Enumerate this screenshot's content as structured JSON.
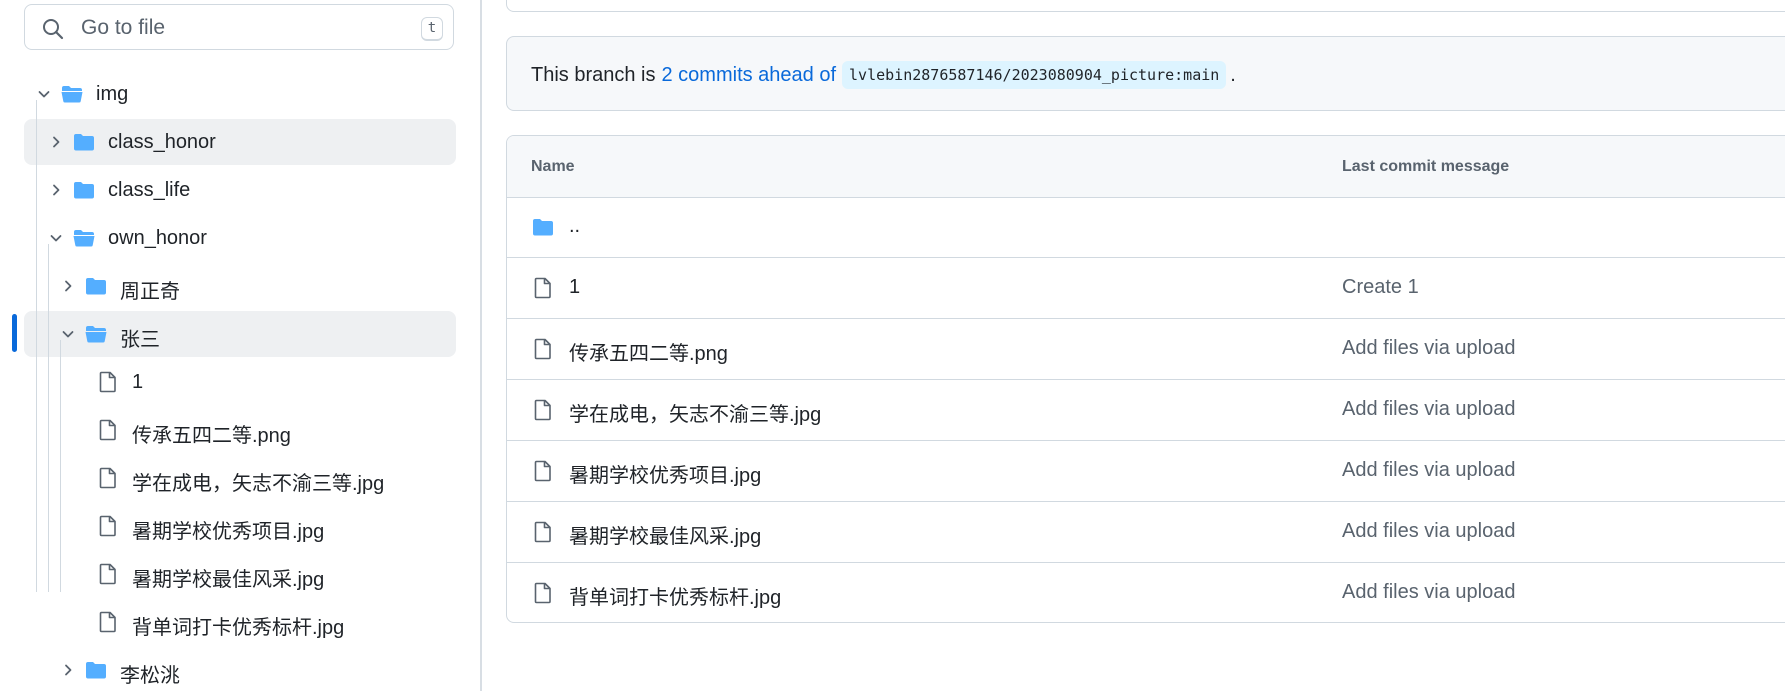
{
  "search": {
    "placeholder": "Go to file",
    "shortcut": "t"
  },
  "tree": [
    {
      "label": "img",
      "type": "folder",
      "state": "open"
    },
    {
      "label": "class_honor",
      "type": "folder",
      "state": "closed",
      "hover": true
    },
    {
      "label": "class_life",
      "type": "folder",
      "state": "closed"
    },
    {
      "label": "own_honor",
      "type": "folder",
      "state": "open"
    },
    {
      "label": "周正奇",
      "type": "folder",
      "state": "closed"
    },
    {
      "label": "张三",
      "type": "folder",
      "state": "open",
      "selected": true
    },
    {
      "label": "1",
      "type": "file"
    },
    {
      "label": "传承五四二等.png",
      "type": "file"
    },
    {
      "label": "学在成电，矢志不渝三等.jpg",
      "type": "file"
    },
    {
      "label": "暑期学校优秀项目.jpg",
      "type": "file"
    },
    {
      "label": "暑期学校最佳风采.jpg",
      "type": "file"
    },
    {
      "label": "背单词打卡优秀标杆.jpg",
      "type": "file"
    },
    {
      "label": "李松洮",
      "type": "folder",
      "state": "closed"
    }
  ],
  "branch": {
    "prefix": "This branch is",
    "ahead_link": "2 commits ahead of",
    "ref": "lvlebin2876587146/2023080904_picture:main",
    "suffix": "."
  },
  "table": {
    "columns": {
      "name": "Name",
      "message": "Last commit message"
    },
    "rows": [
      {
        "name": "..",
        "type": "parent",
        "message": ""
      },
      {
        "name": "1",
        "type": "file",
        "message": "Create 1"
      },
      {
        "name": "传承五四二等.png",
        "type": "file",
        "message": "Add files via upload"
      },
      {
        "name": "学在成电，矢志不渝三等.jpg",
        "type": "file",
        "message": "Add files via upload"
      },
      {
        "name": "暑期学校优秀项目.jpg",
        "type": "file",
        "message": "Add files via upload"
      },
      {
        "name": "暑期学校最佳风采.jpg",
        "type": "file",
        "message": "Add files via upload"
      },
      {
        "name": "背单词打卡优秀标杆.jpg",
        "type": "file",
        "message": "Add files via upload"
      }
    ]
  },
  "colors": {
    "folder": "#54aeff",
    "link": "#0969da",
    "accent": "#0969da",
    "muted": "#59636e"
  }
}
